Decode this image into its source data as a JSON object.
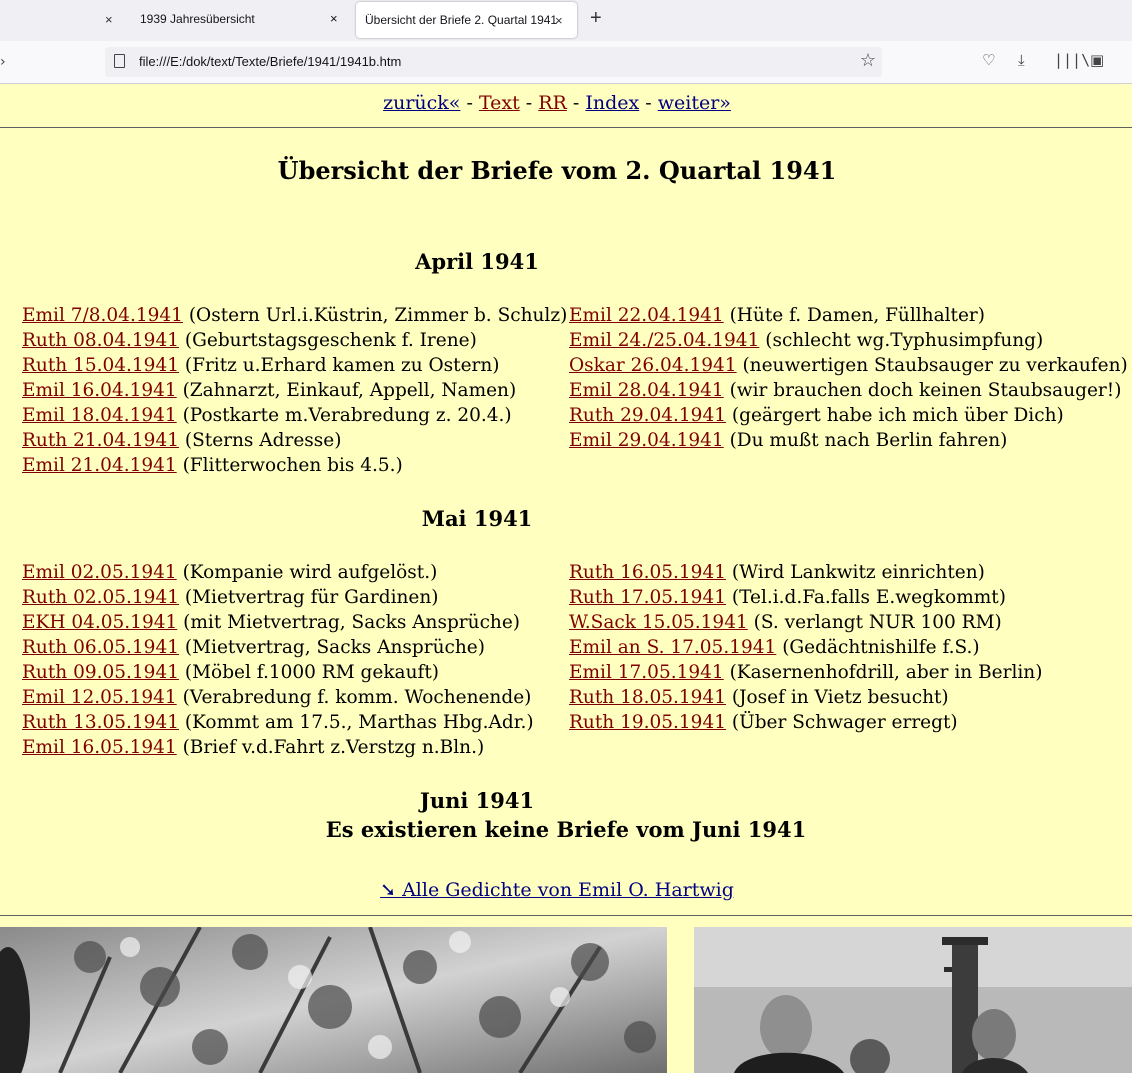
{
  "browser": {
    "tabs": [
      {
        "title": "1939 Jahresübersicht",
        "close": "×"
      },
      {
        "title": "Übersicht der Briefe 2. Quartal 1941",
        "close": "×"
      }
    ],
    "new_tab": "+",
    "url": "file:///E:/dok/text/Texte/Briefe/1941/1941b.htm"
  },
  "nav": {
    "back": "zurück«",
    "text": "Text",
    "rr": "RR",
    "index": "Index",
    "next": "weiter»",
    "sep": " - "
  },
  "title": "Übersicht der Briefe vom 2. Quartal 1941",
  "months": {
    "april": {
      "heading": "April 1941",
      "left": [
        {
          "link": "Emil 7/8.04.1941",
          "desc": "(Ostern Url.i.Küstrin, Zimmer b. Schulz)"
        },
        {
          "link": "Ruth 08.04.1941",
          "desc": "(Geburtstagsgeschenk f. Irene)"
        },
        {
          "link": "Ruth 15.04.1941",
          "desc": "(Fritz u.Erhard kamen zu Ostern)"
        },
        {
          "link": "Emil 16.04.1941",
          "desc": "(Zahnarzt, Einkauf, Appell, Namen)"
        },
        {
          "link": "Emil 18.04.1941",
          "desc": "(Postkarte m.Verabredung z. 20.4.)"
        },
        {
          "link": "Ruth 21.04.1941",
          "desc": "(Sterns Adresse)"
        },
        {
          "link": "Emil 21.04.1941",
          "desc": "(Flitterwochen bis 4.5.)"
        }
      ],
      "right": [
        {
          "link": "Emil 22.04.1941",
          "desc": "(Hüte f. Damen, Füllhalter)"
        },
        {
          "link": "Emil 24./25.04.1941",
          "desc": "(schlecht wg.Typhusimpfung)"
        },
        {
          "link": "Oskar 26.04.1941",
          "desc": "(neuwertigen Staubsauger zu verkaufen)"
        },
        {
          "link": "Emil 28.04.1941",
          "desc": "(wir brauchen doch keinen Staubsauger!)"
        },
        {
          "link": "Ruth 29.04.1941",
          "desc": "(geärgert habe ich mich über Dich)"
        },
        {
          "link": "Emil 29.04.1941",
          "desc": "(Du mußt nach Berlin fahren)"
        }
      ]
    },
    "mai": {
      "heading": "Mai 1941",
      "left": [
        {
          "link": "Emil 02.05.1941",
          "desc": "(Kompanie wird aufgelöst.)"
        },
        {
          "link": "Ruth 02.05.1941",
          "desc": "(Mietvertrag für Gardinen)"
        },
        {
          "link": "EKH 04.05.1941",
          "desc": "(mit Mietvertrag, Sacks Ansprüche)"
        },
        {
          "link": "Ruth 06.05.1941",
          "desc": "(Mietvertrag, Sacks Ansprüche)"
        },
        {
          "link": "Ruth 09.05.1941",
          "desc": "(Möbel f.1000 RM gekauft)"
        },
        {
          "link": "Emil 12.05.1941",
          "desc": "(Verabredung f. komm. Wochenende)"
        },
        {
          "link": "Ruth 13.05.1941",
          "desc": "(Kommt am 17.5., Marthas Hbg.Adr.)"
        },
        {
          "link": "Emil 16.05.1941",
          "desc": "(Brief v.d.Fahrt z.Verstzg n.Bln.)"
        }
      ],
      "right": [
        {
          "link": "Ruth 16.05.1941",
          "desc": "(Wird Lankwitz einrichten)"
        },
        {
          "link": "Ruth 17.05.1941",
          "desc": "(Tel.i.d.Fa.falls E.wegkommt)"
        },
        {
          "link": "W.Sack 15.05.1941",
          "desc": "(S. verlangt NUR 100 RM)"
        },
        {
          "link": "Emil an S. 17.05.1941",
          "desc": "(Gedächtnishilfe f.S.)"
        },
        {
          "link": "Emil 17.05.1941",
          "desc": "(Kasernenhofdrill, aber in Berlin)"
        },
        {
          "link": "Ruth 18.05.1941",
          "desc": "(Josef in Vietz besucht)"
        },
        {
          "link": "Ruth 19.05.1941",
          "desc": "(Über Schwager erregt)"
        }
      ]
    },
    "juni": {
      "heading": "Juni 1941",
      "note": "Es existieren keine Briefe vom Juni 1941"
    }
  },
  "gedichte": {
    "arrow": "➘",
    "link": "Alle Gedichte von Emil O. Hartwig"
  }
}
